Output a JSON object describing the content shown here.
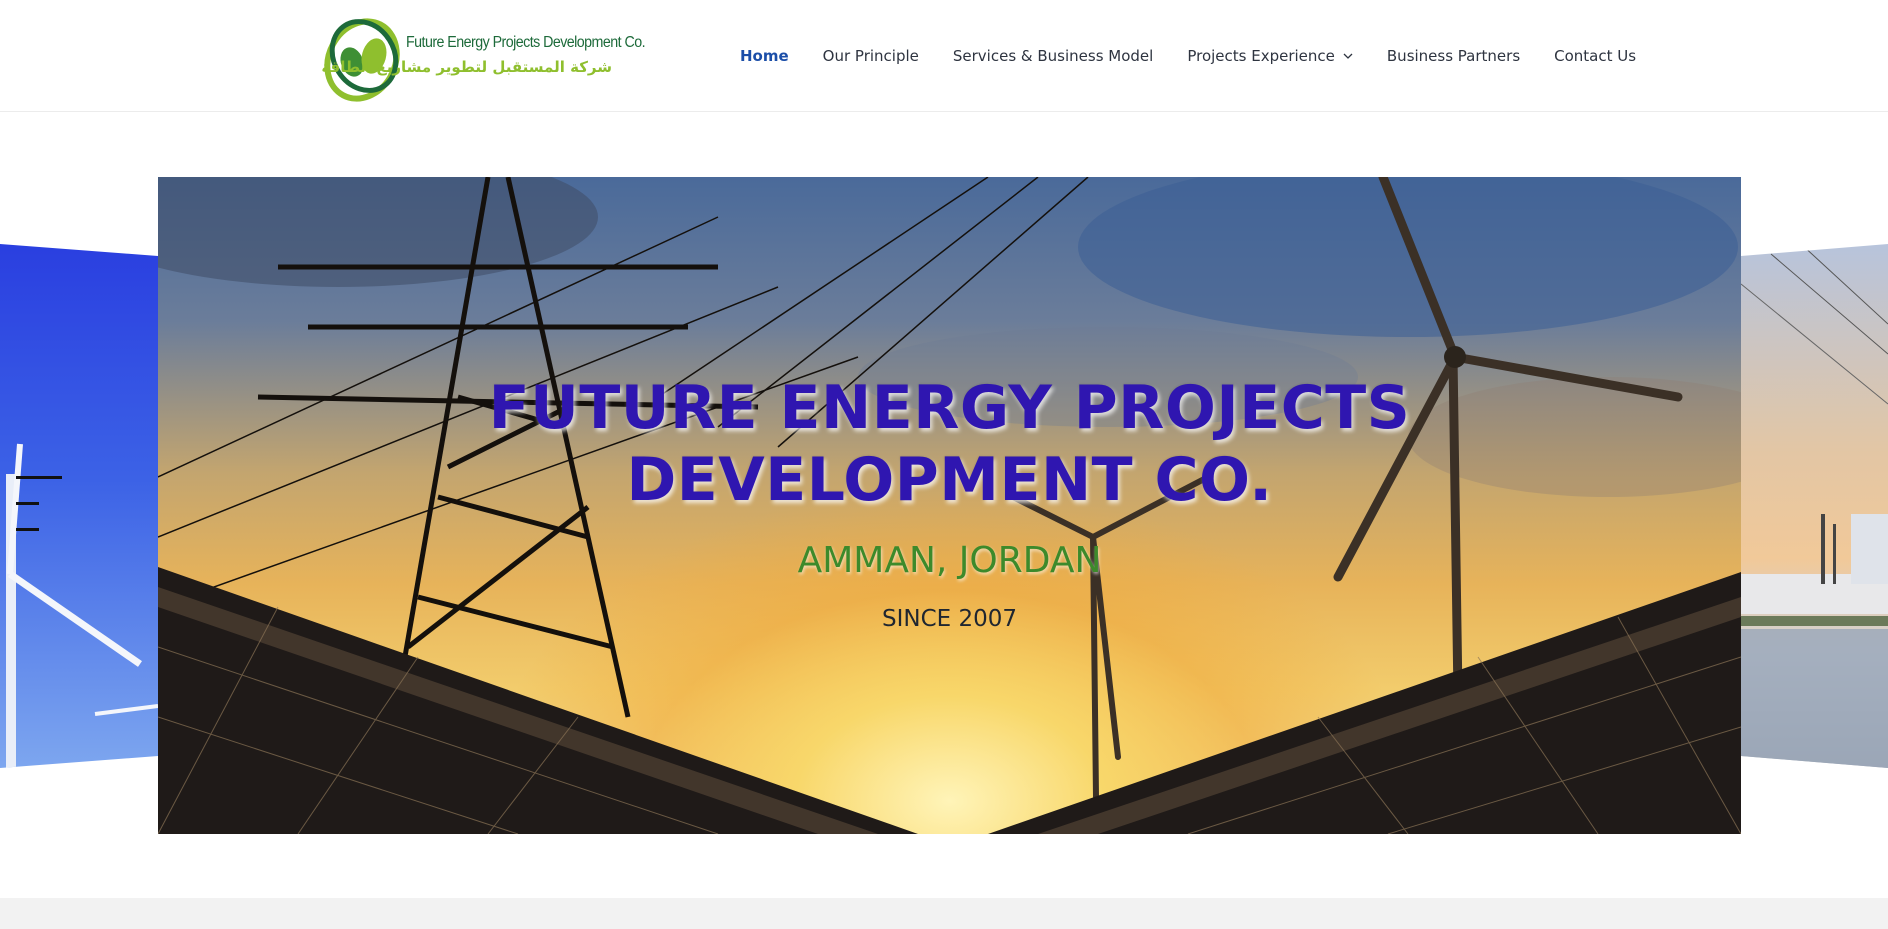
{
  "header": {
    "logo": {
      "name_en": "Future Energy Projects Development Co.",
      "name_ar": "شركة المستقبل لتطوير مشاريع الطاقة"
    },
    "nav": [
      {
        "label": "Home",
        "active": true
      },
      {
        "label": "Our Principle",
        "active": false
      },
      {
        "label": "Services & Business Model",
        "active": false
      },
      {
        "label": "Projects Experience",
        "active": false,
        "has_dropdown": true
      },
      {
        "label": "Business Partners",
        "active": false
      },
      {
        "label": "Contact Us",
        "active": false
      }
    ]
  },
  "hero": {
    "title_line1": "FUTURE ENERGY PROJECTS",
    "title_line2": "DEVELOPMENT CO.",
    "location": "AMMAN, JORDAN",
    "since": "SINCE 2007"
  },
  "colors": {
    "nav_active": "#1b4ea8",
    "hero_title": "#2f16b0",
    "hero_location": "#3d8a2b",
    "logo_dark_green": "#1d6a3a",
    "logo_light_green": "#8fbf2e"
  },
  "icons": {
    "logo": "logo-mark-icon",
    "dropdown": "chevron-down-icon",
    "menu": "menu-toggle-icon"
  }
}
